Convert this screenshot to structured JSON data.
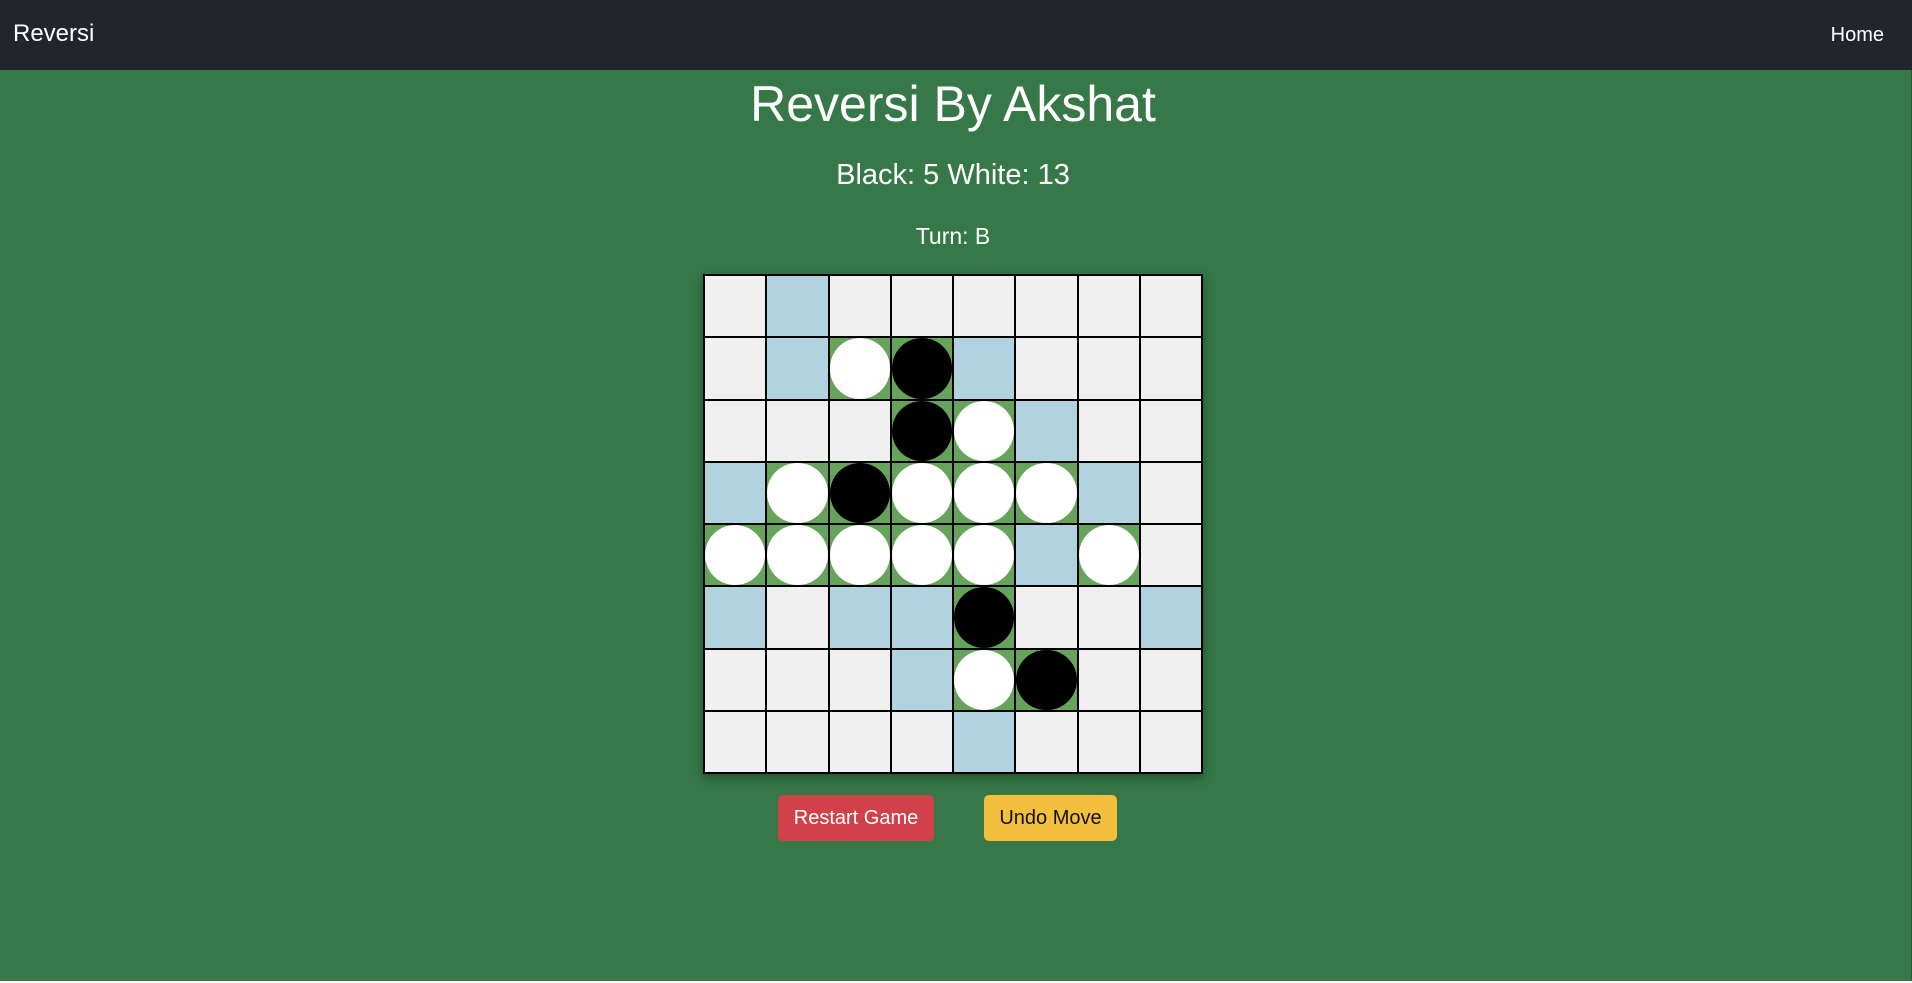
{
  "navbar": {
    "brand": "Reversi",
    "home_link": "Home"
  },
  "game": {
    "title": "Reversi By Akshat",
    "score_text": "Black: 5 White: 13",
    "turn_text": "Turn: B",
    "board": [
      [
        ".",
        "v",
        ".",
        ".",
        ".",
        ".",
        ".",
        "."
      ],
      [
        ".",
        "v",
        "W",
        "B",
        "v",
        ".",
        ".",
        "."
      ],
      [
        ".",
        ".",
        ".",
        "B",
        "W",
        "v",
        ".",
        "."
      ],
      [
        "v",
        "W",
        "B",
        "W",
        "W",
        "W",
        "v",
        "."
      ],
      [
        "W",
        "W",
        "W",
        "W",
        "W",
        "v",
        "W",
        "."
      ],
      [
        "v",
        ".",
        "v",
        "v",
        "B",
        ".",
        ".",
        "v"
      ],
      [
        ".",
        ".",
        ".",
        "v",
        "W",
        "B",
        ".",
        "."
      ],
      [
        ".",
        ".",
        ".",
        ".",
        "v",
        ".",
        ".",
        "."
      ]
    ],
    "board_legend": {
      "B": "black disc",
      "W": "white disc",
      "v": "valid move (highlighted)",
      ".": "empty"
    },
    "colors": {
      "empty_cell": "#f0f0f0",
      "valid_cell": "#b1d3e0",
      "occupied_cell": "#67a45b",
      "background": "#367847"
    }
  },
  "controls": {
    "restart_label": "Restart Game",
    "undo_label": "Undo Move"
  }
}
